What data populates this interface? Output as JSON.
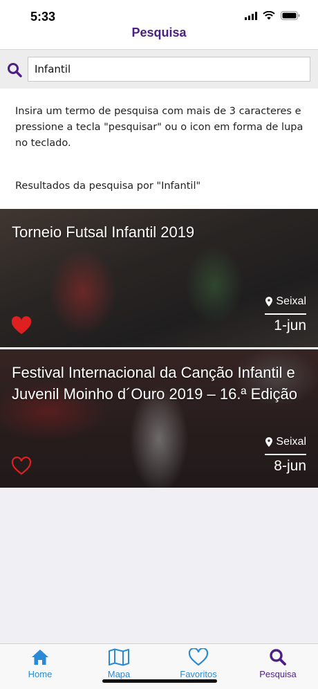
{
  "status_bar": {
    "time": "5:33"
  },
  "nav": {
    "title": "Pesquisa"
  },
  "search": {
    "value": "Infantil",
    "placeholder": ""
  },
  "instructions": "Insira um termo de pesquisa com mais de 3 caracteres e pressione a tecla \"pesquisar\" ou o icon em forma de lupa no teclado.",
  "results_label": "Resultados da pesquisa por \"Infantil\"",
  "results": [
    {
      "title": "Torneio Futsal Infantil 2019",
      "location": "Seixal",
      "date": "1-jun",
      "favorite": true
    },
    {
      "title": "Festival Internacional da Canção Infantil e Juvenil Moinho d´Ouro 2019 – 16.ª Edição",
      "location": "Seixal",
      "date": "8-jun",
      "favorite": false
    }
  ],
  "tabs": [
    {
      "label": "Home",
      "icon": "home-icon"
    },
    {
      "label": "Mapa",
      "icon": "map-icon"
    },
    {
      "label": "Favoritos",
      "icon": "heart-icon"
    },
    {
      "label": "Pesquisa",
      "icon": "search-icon",
      "active": true
    }
  ],
  "colors": {
    "accent": "#4b1f86",
    "tab_blue": "#2b8ad6",
    "favorite_red": "#e02020"
  }
}
